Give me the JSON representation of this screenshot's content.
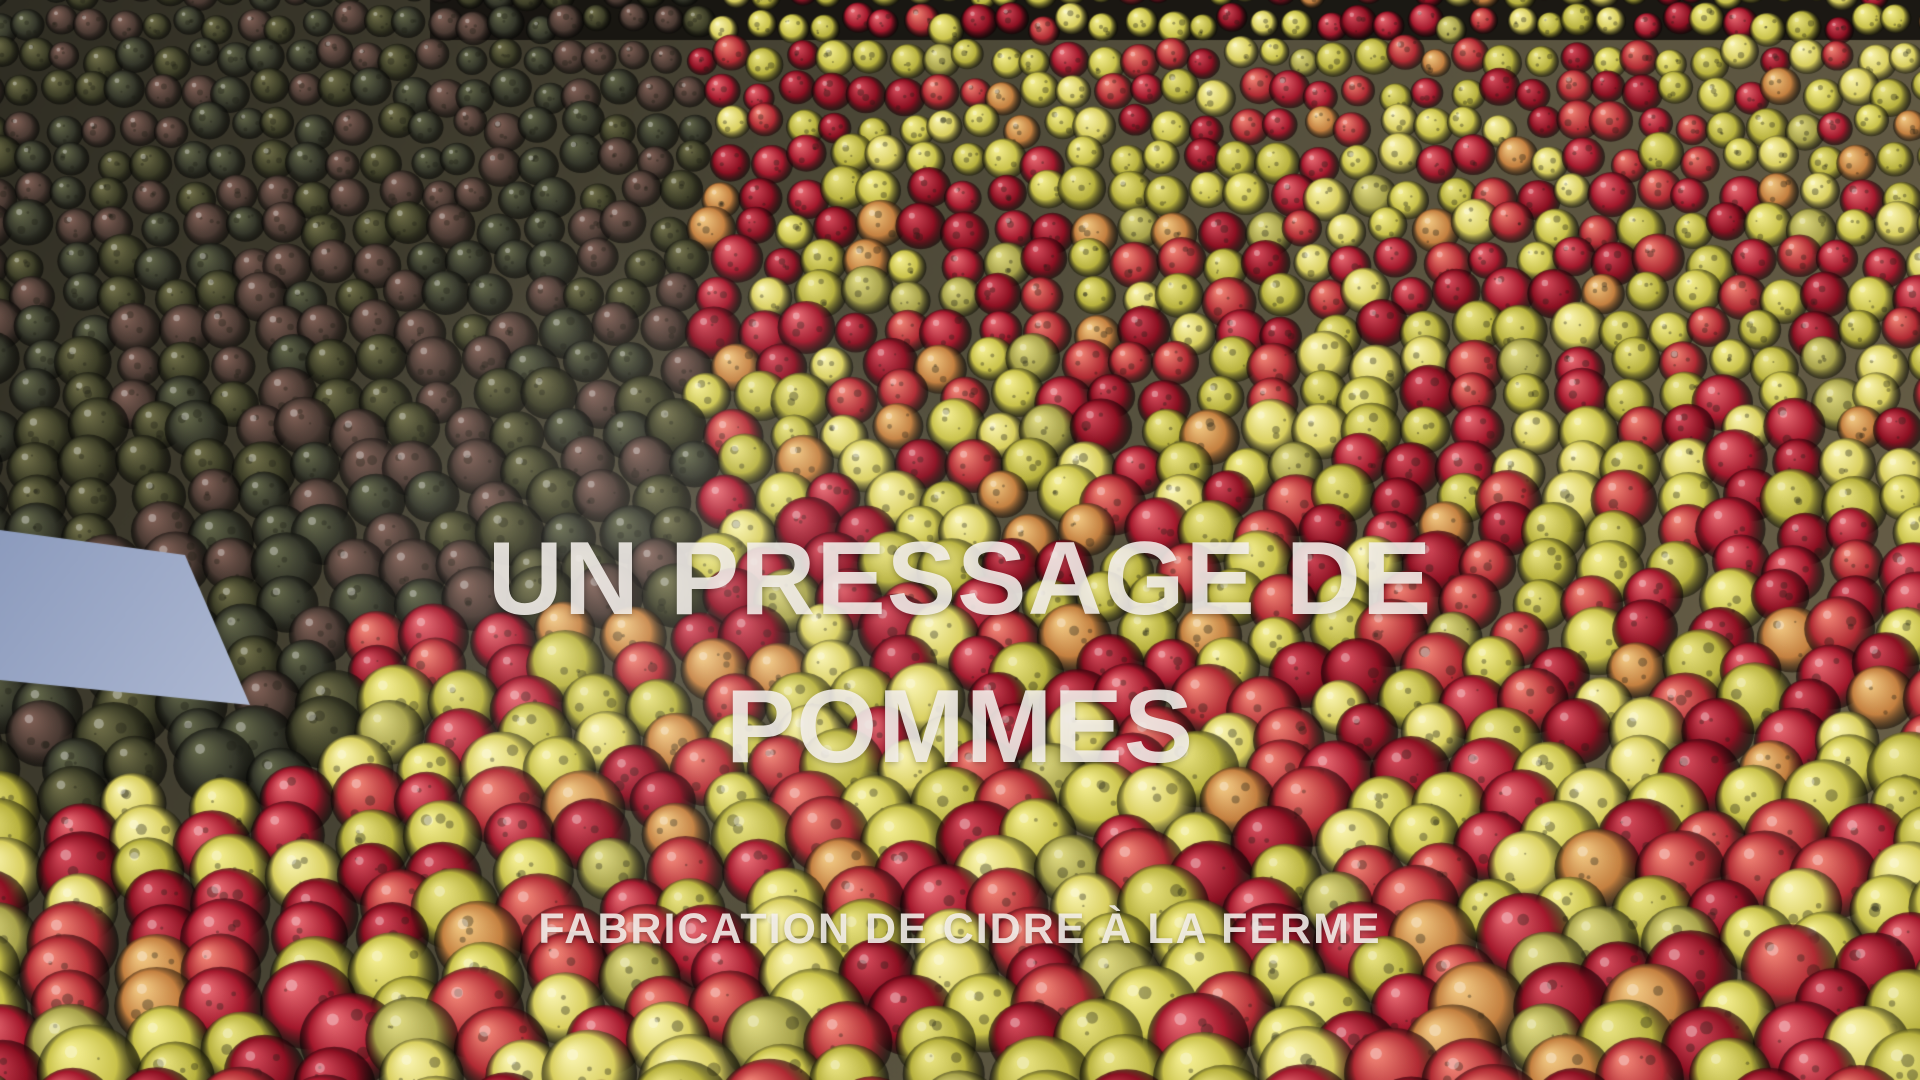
{
  "video_frame": {
    "title_line_1": "UN PRESSAGE DE",
    "title_line_2": "POMMES",
    "subtitle": "FABRICATION DE CIDRE À LA FERME"
  },
  "scene": {
    "subject": "apples-floating-in-washing-water",
    "colors": {
      "water": "#5a5240",
      "dark_apple": "#3f4028",
      "green_apple": "#c9c24a",
      "yellow_apple": "#d9cf5e",
      "red_apple": "#a3182c",
      "chute_metal": "#9aa8c6"
    }
  }
}
